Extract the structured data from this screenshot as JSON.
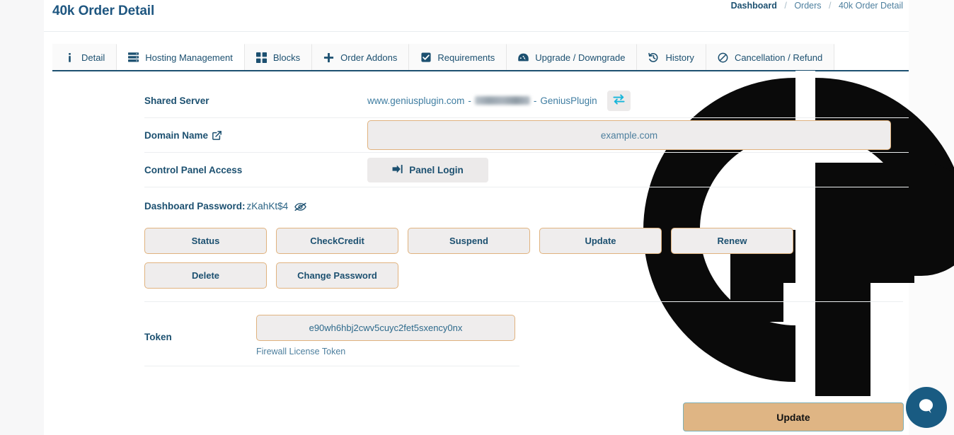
{
  "header": {
    "title": "40k Order Detail",
    "breadcrumb": [
      {
        "label": "Dashboard",
        "current": false
      },
      {
        "label": "Orders",
        "current": false
      },
      {
        "label": "40k Order Detail",
        "current": true
      }
    ],
    "separator": "/"
  },
  "tabs": [
    {
      "label": "Detail",
      "icon": "info-icon",
      "active": false
    },
    {
      "label": "Hosting Management",
      "icon": "server-icon",
      "active": true
    },
    {
      "label": "Blocks",
      "icon": "grid-blocks-icon",
      "active": false
    },
    {
      "label": "Order Addons",
      "icon": "plus-icon",
      "active": false
    },
    {
      "label": "Requirements",
      "icon": "checkbox-checked-icon",
      "active": false
    },
    {
      "label": "Upgrade / Downgrade",
      "icon": "gauge-icon",
      "active": false
    },
    {
      "label": "History",
      "icon": "history-clock-icon",
      "active": false
    },
    {
      "label": "Cancellation / Refund",
      "icon": "ban-icon",
      "active": false
    }
  ],
  "form": {
    "shared_server": {
      "label": "Shared Server",
      "host": "www.geniusplugin.com",
      "dash_1": "-",
      "ip_masked": "",
      "dash_2": "-",
      "provider": "GeniusPlugin",
      "swap_icon": "swap-arrows-icon"
    },
    "domain_name": {
      "label": "Domain Name",
      "external_icon": "external-link-icon",
      "value": "example.com",
      "placeholder": "example.com"
    },
    "control_panel": {
      "label": "Control Panel Access",
      "button_label": "Panel Login",
      "button_icon": "sign-in-icon"
    },
    "dashboard_password": {
      "label": "Dashboard Password",
      "colon": ":",
      "value": "zKahKt$4",
      "toggle_icon": "eye-slash-icon"
    },
    "actions": [
      [
        "Status",
        "CheckCredit",
        "Suspend",
        "Update",
        "Renew"
      ],
      [
        "Delete",
        "Change Password"
      ]
    ],
    "token": {
      "label": "Token",
      "value": "e90wh6hbj2cwv5cuyc2fet5sxency0nx",
      "placeholder": "e90wh6hbj2cwv5cuyc2fet5sxency0nx",
      "help": "Firewall License Token"
    },
    "submit": {
      "label": "Update"
    }
  },
  "watermark": {
    "text": "GP"
  },
  "chat": {
    "icon": "chat-bubble-icon"
  },
  "colors": {
    "brand_blue": "#1c5070",
    "link_blue": "#4d7f9e",
    "accent_tan": "#e0b27e",
    "submit_bg": "#dfb584",
    "submit_border": "#7fb0b5",
    "swap_cyan": "#16b5da",
    "chat_bg": "#195b82",
    "control_bg": "#eceaea"
  }
}
